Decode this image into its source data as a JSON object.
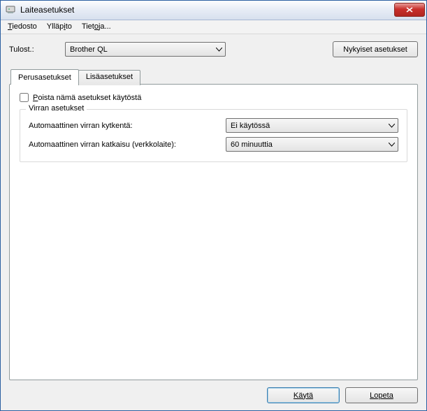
{
  "window": {
    "title": "Laiteasetukset"
  },
  "menu": {
    "file": "Tiedosto",
    "maint": "Ylläpito",
    "info": "Tietoja..."
  },
  "top": {
    "printer_label": "Tulost.:",
    "printer_value": "Brother QL",
    "current_settings": "Nykyiset asetukset"
  },
  "tabs": {
    "basic": "Perusasetukset",
    "extra": "Lisäasetukset"
  },
  "panel": {
    "disable_label": "Poista nämä asetukset käytöstä",
    "group_title": "Virran asetukset",
    "auto_on_label": "Automaattinen virran kytkentä:",
    "auto_on_value": "Ei käytössä",
    "auto_off_label": "Automaattinen virran katkaisu (verkkolaite):",
    "auto_off_value": "60 minuuttia"
  },
  "footer": {
    "apply": "Käytä",
    "exit": "Lopeta"
  }
}
